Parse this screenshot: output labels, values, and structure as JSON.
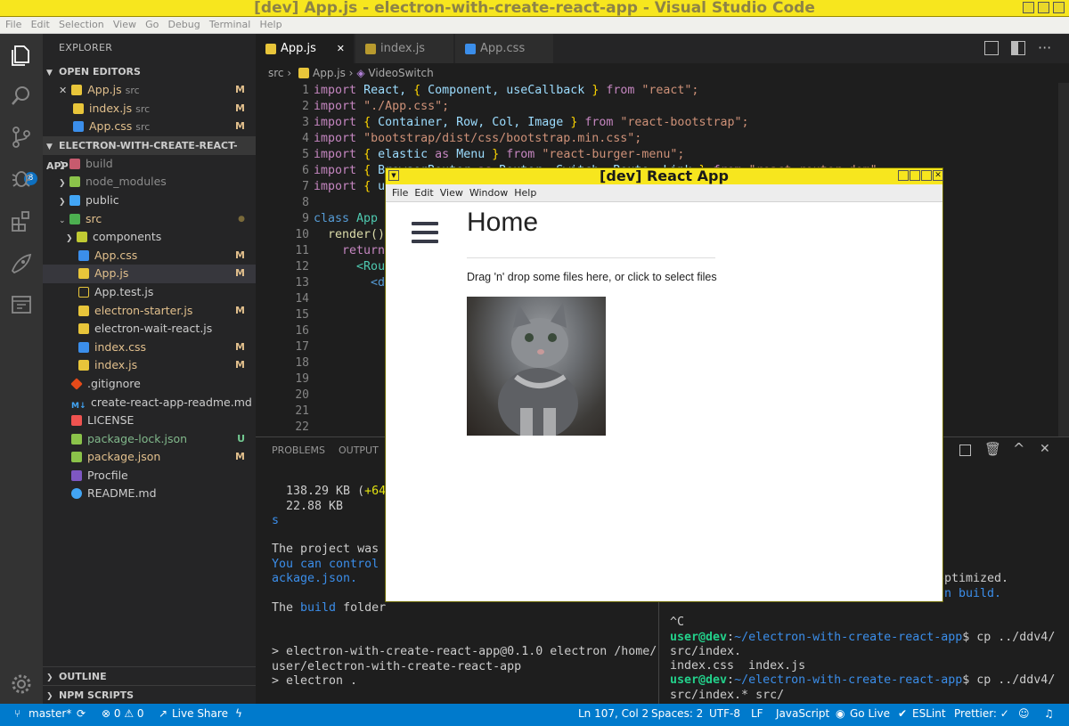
{
  "window": {
    "title": "[dev] App.js - electron-with-create-react-app - Visual Studio Code"
  },
  "menu": [
    "File",
    "Edit",
    "Selection",
    "View",
    "Go",
    "Debug",
    "Terminal",
    "Help"
  ],
  "activity": {
    "scm_badge": "8"
  },
  "explorer": {
    "title": "EXPLORER",
    "open_editors_label": "OPEN EDITORS",
    "open_editors": [
      {
        "name": "App.js",
        "sub": "src",
        "status": "M",
        "close": "✕"
      },
      {
        "name": "index.js",
        "sub": "src",
        "status": "M"
      },
      {
        "name": "App.css",
        "sub": "src",
        "status": "M"
      }
    ],
    "project_label": "ELECTRON-WITH-CREATE-REACT-APP",
    "tree": [
      {
        "name": "build",
        "status": ""
      },
      {
        "name": "node_modules",
        "status": ""
      },
      {
        "name": "public",
        "status": ""
      },
      {
        "name": "src",
        "status": "●"
      },
      {
        "name": "components",
        "status": ""
      },
      {
        "name": "App.css",
        "status": "M"
      },
      {
        "name": "App.js",
        "status": "M"
      },
      {
        "name": "App.test.js",
        "status": ""
      },
      {
        "name": "electron-starter.js",
        "status": "M"
      },
      {
        "name": "electron-wait-react.js",
        "status": ""
      },
      {
        "name": "index.css",
        "status": "M"
      },
      {
        "name": "index.js",
        "status": "M"
      },
      {
        "name": ".gitignore",
        "status": ""
      },
      {
        "name": "create-react-app-readme.md",
        "status": ""
      },
      {
        "name": "LICENSE",
        "status": ""
      },
      {
        "name": "package-lock.json",
        "status": "U"
      },
      {
        "name": "package.json",
        "status": "M"
      },
      {
        "name": "Procfile",
        "status": ""
      },
      {
        "name": "README.md",
        "status": ""
      }
    ],
    "outline_label": "OUTLINE",
    "npm_label": "NPM SCRIPTS"
  },
  "tabs": [
    "App.js",
    "index.js",
    "App.css"
  ],
  "breadcrumbs": {
    "a": "src",
    "b": "App.js",
    "c": "VideoSwitch"
  },
  "gutter": [
    "1",
    "2",
    "3",
    "4",
    "5",
    "6",
    "7",
    "8",
    "9",
    "10",
    "11",
    "12",
    "13",
    "14",
    "15",
    "16",
    "17",
    "18",
    "19",
    "20",
    "21",
    "22"
  ],
  "code": {
    "l1": [
      "import",
      "React,",
      "{",
      "Component,",
      "useCallback",
      "}",
      "from",
      "\"react\";"
    ],
    "l2": [
      "import",
      "\"./App.css\";"
    ],
    "l3": [
      "import",
      "{",
      "Container,",
      "Row,",
      "Col,",
      "Image",
      "}",
      "from",
      "\"react-bootstrap\";"
    ],
    "l4": [
      "import",
      "\"bootstrap/dist/css/bootstrap.min.css\";"
    ],
    "l5": [
      "import",
      "{",
      "elastic",
      "as",
      "Menu",
      "}",
      "from",
      "\"react-burger-menu\";"
    ],
    "l6": [
      "import",
      "{",
      "BrowserRouter",
      "as",
      "Router,",
      "Switch,",
      "Route,",
      "Link",
      "}",
      "from",
      "\"react-router-dom\";"
    ],
    "l7": [
      "import",
      "{",
      "u"
    ],
    "l9": [
      "class",
      "App"
    ],
    "l10": "render()",
    "l11": "return",
    "l12": "<Rou",
    "l13": "<d"
  },
  "panel": {
    "tabs": [
      "PROBLEMS",
      "OUTPUT"
    ],
    "left": {
      "l1a": "  138.29 KB (",
      "l1b": "+64",
      "l2": "  22.88 KB",
      "l3": "s",
      "l5": "The project was",
      "l6": "You can control",
      "l7": "ackage.json.",
      "l9a": "The ",
      "l9b": "build",
      "l9c": " folder",
      "l12": "> electron-with-create-react-app@0.1.0 electron /home/",
      "l13": "user/electron-with-create-react-app",
      "l14": "> electron .",
      "cursor": "▯"
    },
    "right": {
      "r1": "optimized.",
      "r2": "an build.",
      "r4": "^C",
      "user": "user@dev",
      "colon": ":",
      "path": "~/electron-with-create-react-app",
      "cmd1": "$ cp ../ddv4/",
      "cmd1b": "src/index.",
      "cmd1c": "index.css  index.js",
      "cmd2": "$ cp ../ddv4/",
      "cmd2b": "src/index.* src/",
      "cmd3": "$ ",
      "cursor": "▯"
    }
  },
  "popup": {
    "title": "[dev] React App",
    "menu": [
      "File",
      "Edit",
      "View",
      "Window",
      "Help"
    ],
    "heading": "Home",
    "drop_text": "Drag 'n' drop some files here, or click to select files"
  },
  "status": {
    "branch": "master*",
    "problems": "⊗ 0 ⚠ 0",
    "liveshare": "Live Share",
    "position": "Ln 107, Col 2",
    "spaces": "Spaces: 2",
    "encoding": "UTF-8",
    "eol": "LF",
    "language": "JavaScript",
    "golive": "Go Live",
    "eslint": "ESLint",
    "prettier": "Prettier: ✓"
  }
}
